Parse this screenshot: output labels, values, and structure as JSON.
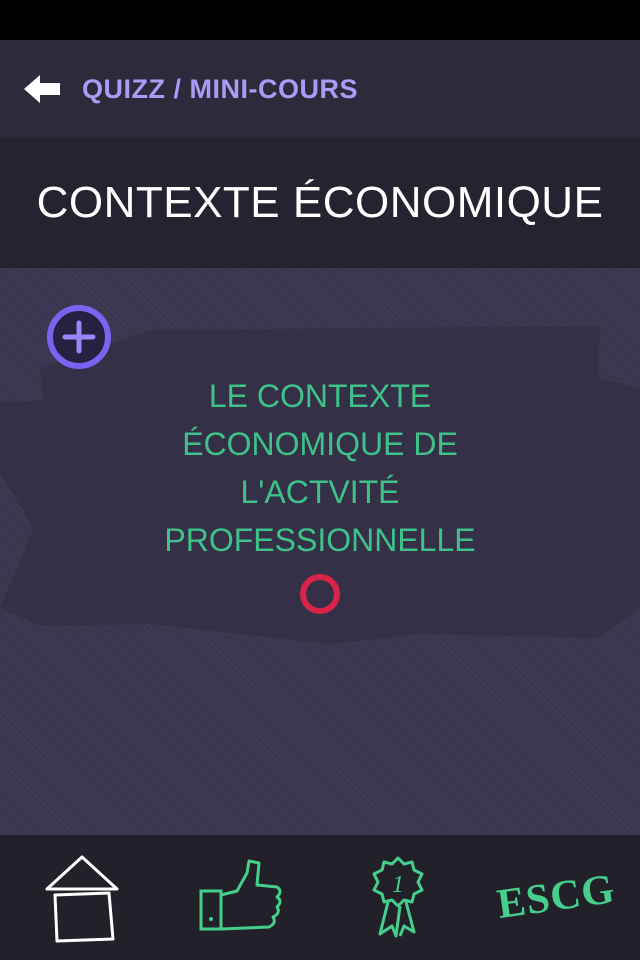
{
  "header": {
    "breadcrumb": "QUIZZ / MINI-COURS"
  },
  "page": {
    "title": "CONTEXTE ÉCONOMIQUE"
  },
  "card": {
    "line1": "LE CONTEXTE",
    "line2": "ÉCONOMIQUE DE",
    "line3": "L'ACTVITÉ",
    "line4": "PROFESSIONNELLE"
  },
  "bottom_nav": {
    "items": [
      "home-icon",
      "thumbs-up-icon",
      "award-ribbon-icon",
      "escg-logo"
    ],
    "ranking_badge": "1",
    "logo_text": "ESCG"
  },
  "colors": {
    "accent_purple": "#7b63f0",
    "breadcrumb": "#a99cf7",
    "card_text": "#3ec28a",
    "ring": "#d9244a",
    "nav_icon_green": "#45cf8c",
    "home_icon": "#ffffff"
  }
}
